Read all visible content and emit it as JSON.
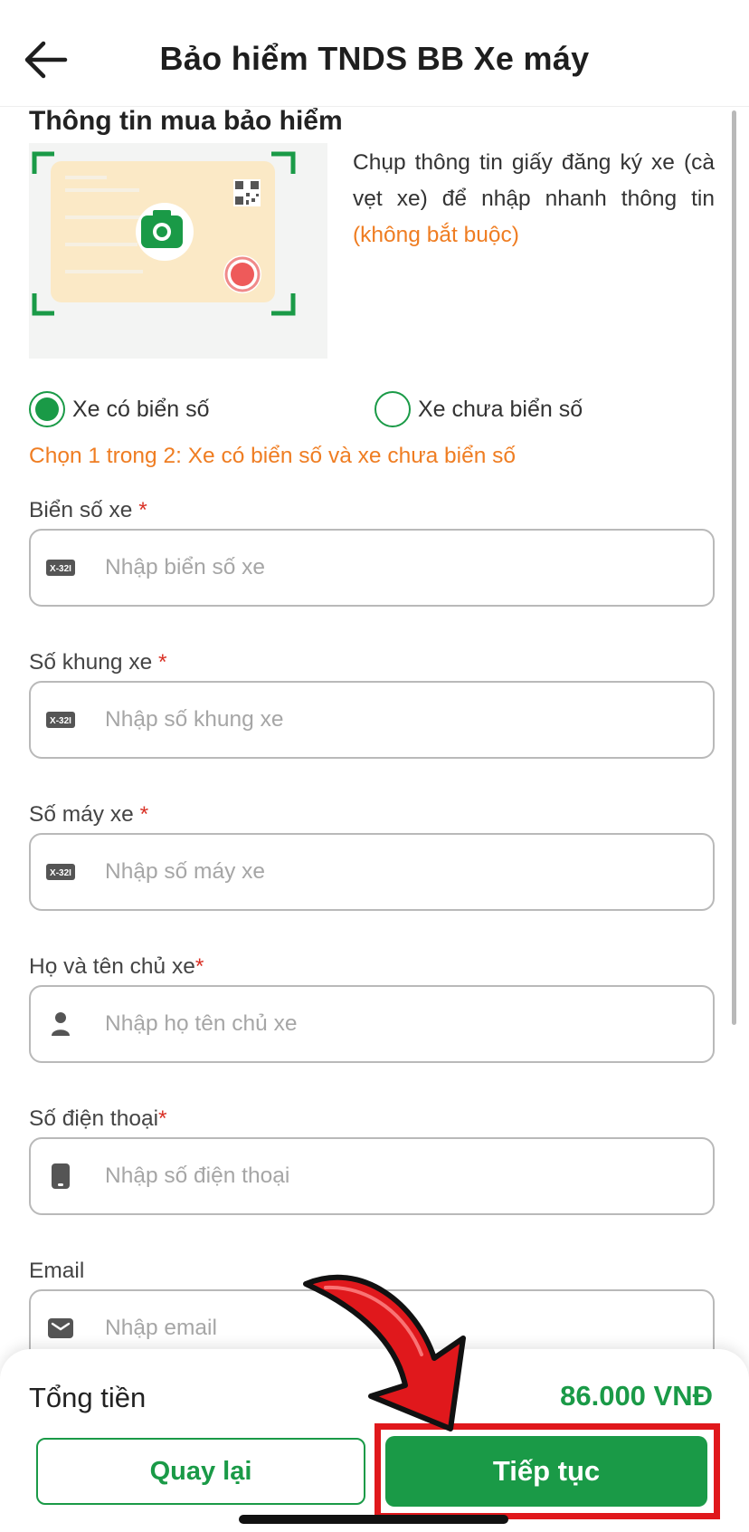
{
  "header": {
    "title": "Bảo hiểm TNDS BB Xe máy",
    "back_icon": "arrow-left-icon"
  },
  "section": {
    "title": "Thông tin mua bảo hiểm"
  },
  "scan": {
    "text": "Chụp thông tin giấy đăng ký xe (cà vẹt xe) để nhập nhanh thông tin",
    "optional": "(không bắt buộc)",
    "icon": "camera-icon"
  },
  "vehicle_type": {
    "options": [
      "Xe có biển số",
      "Xe chưa biển số"
    ],
    "selected": "Xe có biển số",
    "hint": "Chọn 1 trong 2: Xe có biển số và xe chưa biển số"
  },
  "fields": [
    {
      "label": "Biển số xe",
      "required_mark": "*",
      "placeholder": "Nhập biển số xe",
      "icon": "license-plate-icon"
    },
    {
      "label": "Số khung xe",
      "required_mark": "*",
      "placeholder": "Nhập số khung xe",
      "icon": "license-plate-icon"
    },
    {
      "label": "Số máy xe",
      "required_mark": "*",
      "placeholder": "Nhập số máy xe",
      "icon": "license-plate-icon"
    },
    {
      "label": "Họ và tên chủ xe",
      "required_mark": "*",
      "placeholder": "Nhập họ tên chủ xe",
      "icon": "user-icon"
    },
    {
      "label": "Số điện thoại",
      "required_mark": "*",
      "placeholder": "Nhập số điện thoại",
      "icon": "phone-icon"
    },
    {
      "label": "Email",
      "required_mark": "",
      "placeholder": "Nhập email",
      "icon": "mail-icon"
    }
  ],
  "footer": {
    "total_label": "Tổng tiền",
    "total_value": "86.000 VNĐ",
    "back_button": "Quay lại",
    "next_button": "Tiếp tục"
  },
  "colors": {
    "primary": "#1a9a47",
    "accent": "#ef7d22",
    "highlight": "#e0181c"
  }
}
